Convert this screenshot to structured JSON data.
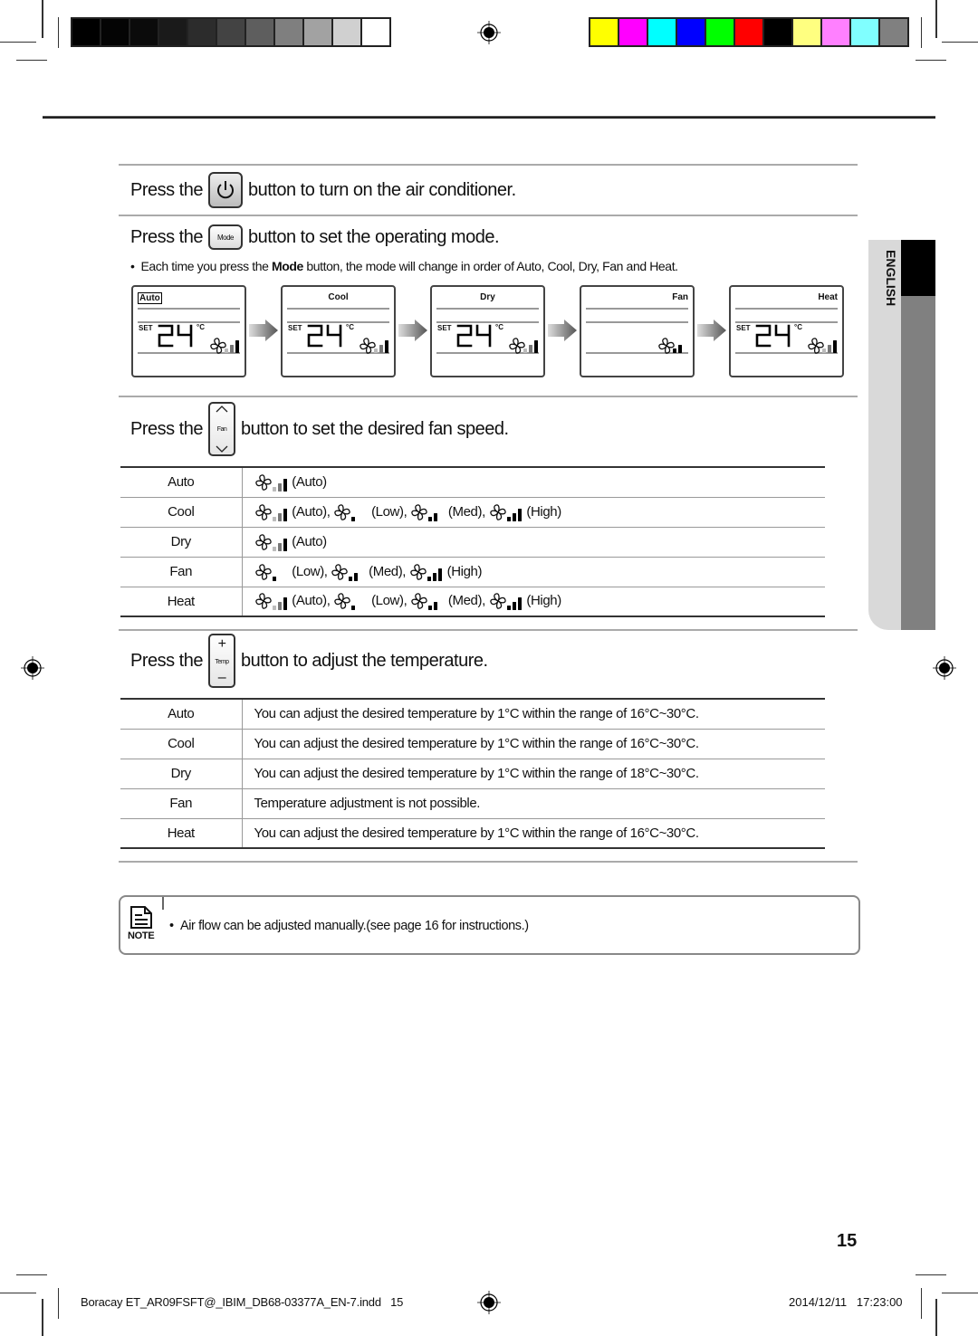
{
  "color_bars": {
    "gray": [
      "#000000",
      "#040404",
      "#0b0b0b",
      "#1a1a1a",
      "#2c2c2c",
      "#434343",
      "#5e5e5e",
      "#7f7f7f",
      "#a2a2a2",
      "#d0d0d0",
      "#ffffff"
    ],
    "color": [
      "#ffff00",
      "#ff00ff",
      "#00ffff",
      "#0000ff",
      "#00ff00",
      "#ff0000",
      "#000000",
      "#ffff80",
      "#ff80ff",
      "#80ffff",
      "#808080"
    ]
  },
  "section_power": {
    "prefix": "Press the",
    "suffix": "button to turn on the air conditioner.",
    "button_icon": "power-icon"
  },
  "section_mode": {
    "prefix": "Press the",
    "button_label": "Mode",
    "suffix": "button to set the operating mode.",
    "bullet_pre": "Each time you press the ",
    "bullet_bold": "Mode",
    "bullet_post": " button, the mode will change in order of Auto, Cool, Dry, Fan and Heat.",
    "panels": [
      {
        "mode": "Auto",
        "set_label": "SET",
        "temp": "24",
        "unit": "°C",
        "fan_level": "auto",
        "shows_temp": true
      },
      {
        "mode": "Cool",
        "set_label": "SET",
        "temp": "24",
        "unit": "°C",
        "fan_level": "auto",
        "shows_temp": true
      },
      {
        "mode": "Dry",
        "set_label": "SET",
        "temp": "24",
        "unit": "°C",
        "fan_level": "auto",
        "shows_temp": true
      },
      {
        "mode": "Fan",
        "set_label": "",
        "temp": "",
        "unit": "",
        "fan_level": "med",
        "shows_temp": false
      },
      {
        "mode": "Heat",
        "set_label": "SET",
        "temp": "24",
        "unit": "°C",
        "fan_level": "auto",
        "shows_temp": true
      }
    ]
  },
  "section_fan": {
    "prefix": "Press the",
    "button_label": "Fan",
    "suffix": "button to set the desired fan speed.",
    "rows": [
      {
        "mode": "Auto",
        "options": [
          {
            "level": "auto",
            "label": "(Auto)"
          }
        ]
      },
      {
        "mode": "Cool",
        "options": [
          {
            "level": "auto",
            "label": "(Auto),"
          },
          {
            "level": "low",
            "label": "(Low),"
          },
          {
            "level": "med",
            "label": "(Med),"
          },
          {
            "level": "high",
            "label": "(High)"
          }
        ]
      },
      {
        "mode": "Dry",
        "options": [
          {
            "level": "auto",
            "label": "(Auto)"
          }
        ]
      },
      {
        "mode": "Fan",
        "options": [
          {
            "level": "low",
            "label": "(Low),"
          },
          {
            "level": "med",
            "label": "(Med),"
          },
          {
            "level": "high",
            "label": "(High)"
          }
        ]
      },
      {
        "mode": "Heat",
        "options": [
          {
            "level": "auto",
            "label": "(Auto),"
          },
          {
            "level": "low",
            "label": "(Low),"
          },
          {
            "level": "med",
            "label": "(Med),"
          },
          {
            "level": "high",
            "label": "(High)"
          }
        ]
      }
    ]
  },
  "section_temp": {
    "prefix": "Press the",
    "button_label": "Temp",
    "plus": "+",
    "minus": "–",
    "suffix": "button to adjust the temperature.",
    "rows": [
      {
        "mode": "Auto",
        "text": "You can adjust the desired temperature by 1°C within the range of 16°C~30°C."
      },
      {
        "mode": "Cool",
        "text": "You can adjust the desired temperature by 1°C within the range of 16°C~30°C."
      },
      {
        "mode": "Dry",
        "text": "You can adjust the desired temperature by 1°C within the range of 18°C~30°C."
      },
      {
        "mode": "Fan",
        "text": "Temperature adjustment is not possible."
      },
      {
        "mode": "Heat",
        "text": "You can adjust the desired temperature by 1°C within the range of 16°C~30°C."
      }
    ]
  },
  "sidebar": {
    "language_label": "ENGLISH"
  },
  "note": {
    "label": "NOTE",
    "text": "Air flow can be adjusted manually.(see page 16 for instructions.)"
  },
  "footer": {
    "page_number": "15",
    "slug": "Boracay ET_AR09FSFT@_IBIM_DB68-03377A_EN-7.indd   15",
    "timestamp": "2014/12/11   17:23:00"
  }
}
